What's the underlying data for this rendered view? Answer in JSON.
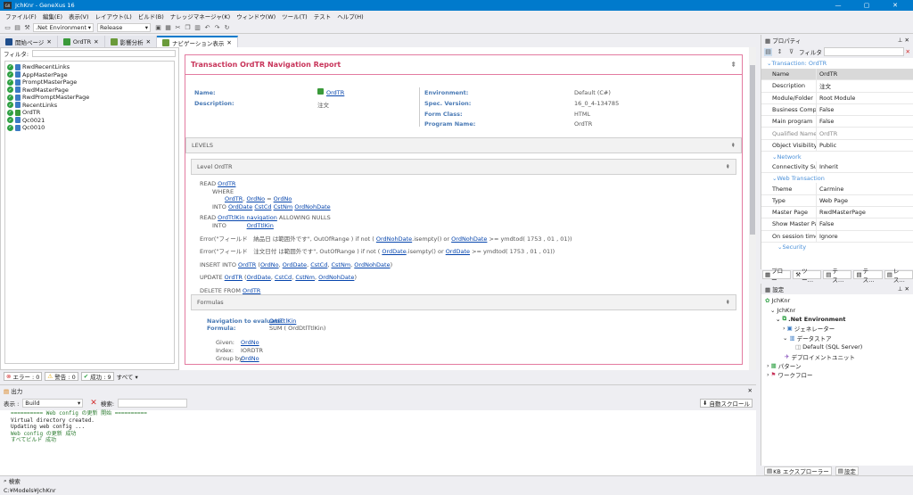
{
  "window": {
    "title": "JchKnr - GeneXus 16",
    "minimize": "—",
    "maximize": "▢",
    "close": "✕"
  },
  "menu": [
    "ファイル(F)",
    "編集(E)",
    "表示(V)",
    "レイアウト(L)",
    "ビルド(B)",
    "ナレッジマネージャ(K)",
    "ウィンドウ(W)",
    "ツール(T)",
    "テスト",
    "ヘルプ(H)"
  ],
  "toolbar": {
    "environment": ".Net Environment",
    "configuration": "Release"
  },
  "tabs": [
    "開始ページ",
    "OrdTR",
    "影響分析",
    "ナビゲーション表示"
  ],
  "left": {
    "filter_label": "フィルタ:",
    "objects": [
      "RwdRecentLinks",
      "AppMasterPage",
      "PromptMasterPage",
      "RwdMasterPage",
      "RwdPromptMasterPage",
      "RecentLinks",
      "OrdTR",
      "Qc0021",
      "Qc0010"
    ]
  },
  "report": {
    "title": "Transaction OrdTR Navigation Report",
    "name_label": "Name:",
    "name": "OrdTR",
    "desc_label": "Description:",
    "desc": "注文",
    "env_label": "Environment:",
    "env": "Default (C#)",
    "spec_label": "Spec. Version:",
    "spec": "16_0_4-134785",
    "form_label": "Form Class:",
    "form": "HTML",
    "prog_label": "Program Name:",
    "prog": "OrdTR",
    "levels": "LEVELS",
    "level": "Level OrdTR",
    "formulas": "Formulas",
    "nav_label": "Navigation to evaluate:",
    "nav_val": "OrdTtlKin",
    "formula_label": "Formula:",
    "formula_val": "SUM ( OrdDtlTtlKin)",
    "given_label": "Given:",
    "given_val": "OrdNo",
    "index_label": "Index:",
    "index_val": "IORDTR",
    "groupby_label": "Group by:",
    "groupby_val": "OrdNo"
  },
  "status": {
    "errors": "エラー : 0",
    "warnings": "警告 : 0",
    "success": "成功 : 9",
    "all": "すべて ▾"
  },
  "output": {
    "title": "出力",
    "show_label": "表示 :",
    "build": "Build",
    "search_label": "検索:",
    "autoscroll": "自動スクロール",
    "lines": [
      "========== Web config の更新 開始 ==========",
      "Virtual directory created.",
      "Updating web config ...",
      "Web config の更新 成功",
      "すべてビルド 成功"
    ]
  },
  "search": "検索",
  "bottom": {
    "path": "C:¥Models¥JchKnr"
  },
  "props": {
    "title": "プロパティ",
    "filter": "フィルタ",
    "category": "Transaction: OrdTR",
    "rows": [
      {
        "n": "Name",
        "v": "OrdTR"
      },
      {
        "n": "Description",
        "v": "注文"
      },
      {
        "n": "Module/Folder",
        "v": "Root Module"
      },
      {
        "n": "Business Component",
        "v": "False"
      },
      {
        "n": "Main program",
        "v": "False"
      },
      {
        "n": "Qualified Name",
        "v": "OrdTR"
      },
      {
        "n": "Object Visibility",
        "v": "Public"
      }
    ],
    "network": "Network",
    "conn_n": "Connectivity Supp",
    "conn_v": "Inherit",
    "webtrn": "Web Transaction",
    "rows2": [
      {
        "n": "Theme",
        "v": "Carmine"
      },
      {
        "n": "Type",
        "v": "Web Page"
      },
      {
        "n": "Master Page",
        "v": "RwdMasterPage"
      },
      {
        "n": "Show Master Page",
        "v": "False"
      },
      {
        "n": "On session timeou",
        "v": "Ignore"
      }
    ],
    "security": "Security",
    "tabs": [
      "プロー",
      "ツー…",
      "テス…",
      "テス…",
      "レス…"
    ]
  },
  "settings": {
    "title": "設定",
    "nodes": [
      "JchKnr",
      "JchKnr",
      ".Net Environment",
      "ジェネレーター",
      "データストア",
      "Default (SQL Server)",
      "デプロイメントユニット",
      "パターン",
      "ワークフロー"
    ],
    "tabs": [
      "KB エクスプローラー",
      "設定"
    ]
  },
  "colors": {
    "accent": "#007acc",
    "title": "#c8345a",
    "label": "#4a7ab5",
    "link": "#0645ad",
    "success": "#2ea043"
  }
}
